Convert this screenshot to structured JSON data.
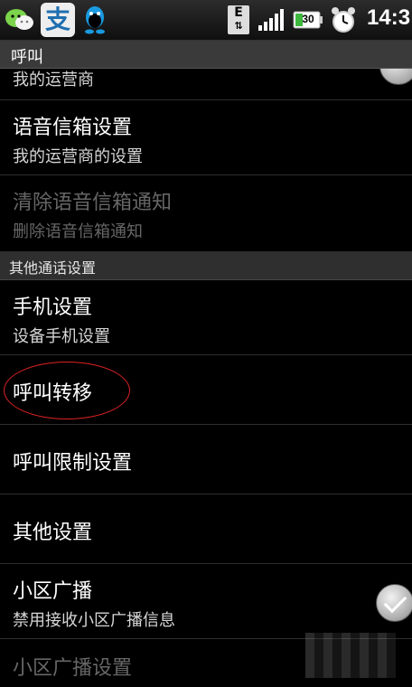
{
  "statusbar": {
    "edge_label": "E",
    "battery": "30",
    "time": "14:3"
  },
  "title": "呼叫",
  "list": {
    "partial_top_summary": "我的运营商",
    "voicemail_settings": {
      "title": "语音信箱设置",
      "summary": "我的运营商的设置"
    },
    "clear_voicemail": {
      "title": "清除语音信箱通知",
      "summary": "删除语音信箱通知"
    },
    "section_other": "其他通话设置",
    "phone_settings": {
      "title": "手机设置",
      "summary": "设备手机设置"
    },
    "call_forwarding": {
      "title": "呼叫转移"
    },
    "call_barring": {
      "title": "呼叫限制设置"
    },
    "other_settings": {
      "title": "其他设置"
    },
    "cell_broadcast": {
      "title": "小区广播",
      "summary": "禁用接收小区广播信息",
      "checked": true
    },
    "cell_broadcast_settings": {
      "title": "小区广播设置"
    }
  },
  "colors": {
    "annotation": "#d22222"
  }
}
